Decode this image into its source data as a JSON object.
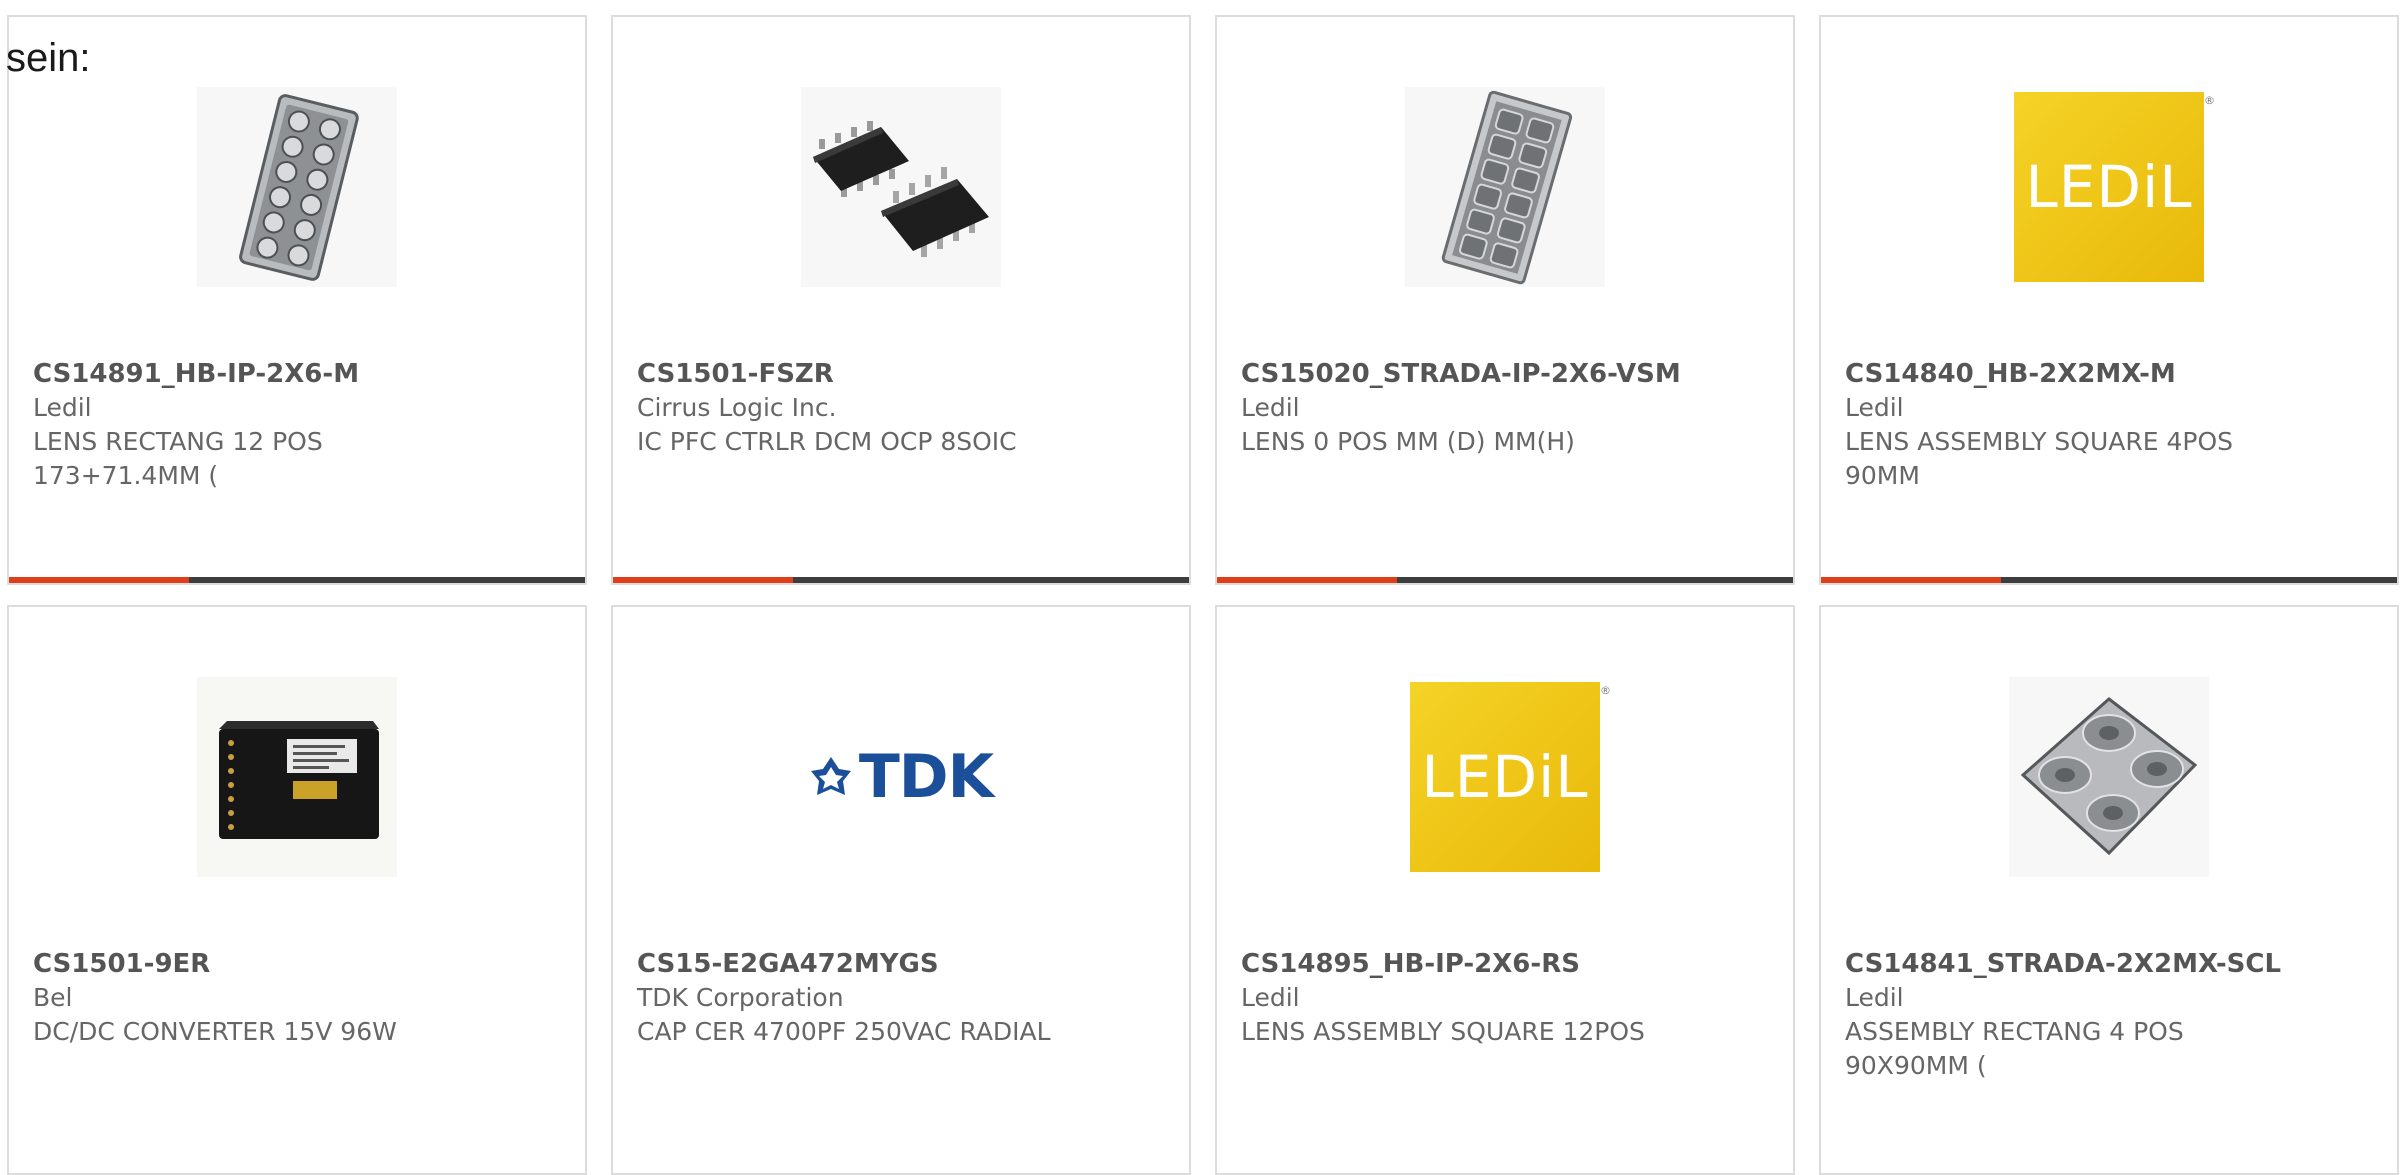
{
  "intro_text": "sein:",
  "colors": {
    "accent": "#e03e1a",
    "bar": "#3d3d3d",
    "logo_yellow": "#f1c40f",
    "tdk_blue": "#1c4f99"
  },
  "products": [
    {
      "part_number": "CS14891_HB-IP-2X6-M",
      "manufacturer": "Ledil",
      "description": "LENS RECTANG 12 POS\n173+71.4MM (",
      "image": "lens-rectangular-12pos-photo"
    },
    {
      "part_number": "CS1501-FSZR",
      "manufacturer": "Cirrus Logic Inc.",
      "description": "IC PFC CTRLR DCM OCP 8SOIC",
      "image": "soic8-ic-photo"
    },
    {
      "part_number": "CS15020_STRADA-IP-2X6-VSM",
      "manufacturer": "Ledil",
      "description": "LENS 0 POS MM (D) MM(H)",
      "image": "lens-strada-photo"
    },
    {
      "part_number": "CS14840_HB-2X2MX-M",
      "manufacturer": "Ledil",
      "description": "LENS ASSEMBLY SQUARE 4POS\n90MM",
      "image": "ledil-logo",
      "logo_text": "LEDiL"
    },
    {
      "part_number": "CS1501-9ER",
      "manufacturer": "Bel",
      "description": "DC/DC CONVERTER 15V 96W",
      "image": "dc-dc-converter-photo"
    },
    {
      "part_number": "CS15-E2GA472MYGS",
      "manufacturer": "TDK Corporation",
      "description": "CAP CER 4700PF 250VAC RADIAL",
      "image": "tdk-logo",
      "logo_text": "TDK"
    },
    {
      "part_number": "CS14895_HB-IP-2X6-RS",
      "manufacturer": "Ledil",
      "description": "LENS ASSEMBLY SQUARE 12POS",
      "image": "ledil-logo",
      "logo_text": "LEDiL"
    },
    {
      "part_number": "CS14841_STRADA-2X2MX-SCL",
      "manufacturer": "Ledil",
      "description": "ASSEMBLY RECTANG 4 POS\n90X90MM (",
      "image": "lens-square-4pos-photo"
    }
  ]
}
